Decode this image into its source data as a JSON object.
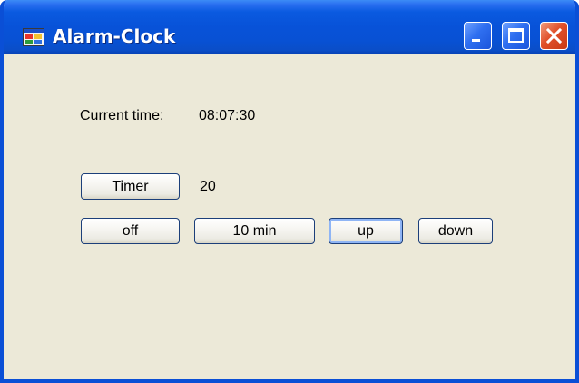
{
  "window": {
    "title": "Alarm-Clock",
    "app_icon": "window-app-icon",
    "caption_buttons": {
      "minimize": "minimize-icon",
      "maximize": "maximize-icon",
      "close": "close-icon"
    },
    "colors": {
      "titlebar": "#0852d8",
      "client_background": "#ece9d8",
      "close_button": "#e0502a"
    }
  },
  "clock": {
    "label": "Current time:",
    "value": "08:07:30"
  },
  "timer": {
    "button_label": "Timer",
    "value": "20"
  },
  "controls": {
    "off_label": "off",
    "ten_min_label": "10 min",
    "up_label": "up",
    "down_label": "down"
  }
}
